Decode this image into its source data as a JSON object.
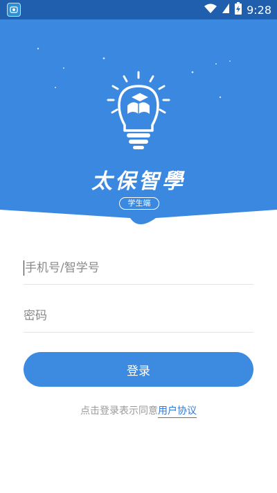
{
  "status_bar": {
    "time": "9:28"
  },
  "brand": {
    "title": "太保智學",
    "role_badge": "学生端"
  },
  "form": {
    "phone_placeholder": "手机号/智学号",
    "password_placeholder": "密码",
    "login_label": "登录"
  },
  "agreement": {
    "prefix": "点击登录表示同意",
    "link_label": "用户协议"
  },
  "colors": {
    "primary": "#3d8be0",
    "status_bar": "#1f5fae",
    "link": "#2f78d6"
  }
}
